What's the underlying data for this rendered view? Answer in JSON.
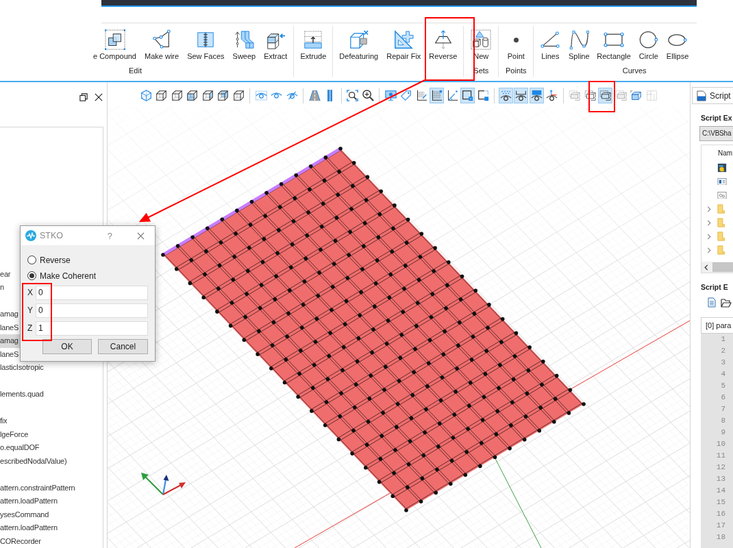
{
  "ribbon": {
    "groups": [
      {
        "label": "Edit",
        "buttons": [
          {
            "kind": "compound",
            "label": "e Compound"
          },
          {
            "kind": "wire",
            "label": "Make wire"
          },
          {
            "kind": "sew",
            "label": "Sew Faces"
          },
          {
            "kind": "sweep",
            "label": "Sweep"
          },
          {
            "kind": "extract",
            "label": "Extract"
          }
        ]
      },
      {
        "buttons": [
          {
            "kind": "extrude",
            "label": "Extrude"
          }
        ]
      },
      {
        "buttons": [
          {
            "kind": "defeature",
            "label": "Defeaturing"
          },
          {
            "kind": "repair",
            "label": "Repair Fix"
          },
          {
            "kind": "reverse",
            "label": "Reverse"
          }
        ]
      },
      {
        "label": "Sets",
        "buttons": [
          {
            "kind": "sets",
            "label": "New"
          }
        ]
      },
      {
        "label": "Points",
        "buttons": [
          {
            "kind": "point",
            "label": "Point"
          }
        ]
      },
      {
        "label": "Curves",
        "buttons": [
          {
            "kind": "line",
            "label": "Lines"
          },
          {
            "kind": "spline",
            "label": "Spline"
          },
          {
            "kind": "rectangle",
            "label": "Rectangle"
          },
          {
            "kind": "circle",
            "label": "Circle"
          },
          {
            "kind": "ellipse",
            "label": "Ellipse"
          }
        ]
      }
    ]
  },
  "view_toolbar": {
    "groups": [
      [
        {
          "kind": "iso",
          "on": false
        },
        {
          "kind": "cube",
          "on": false
        },
        {
          "kind": "cube",
          "on": false
        },
        {
          "kind": "cubefront",
          "on": false
        },
        {
          "kind": "cubeside",
          "on": false
        },
        {
          "kind": "cubeback",
          "on": false
        },
        {
          "kind": "cube",
          "on": false
        }
      ],
      [
        {
          "kind": "eyeframe",
          "on": false
        },
        {
          "kind": "eye",
          "on": false
        },
        {
          "kind": "eyeslash",
          "on": false
        }
      ],
      [
        {
          "kind": "road",
          "on": false
        },
        {
          "kind": "bar",
          "on": false
        }
      ],
      [
        {
          "kind": "zoomfit",
          "on": false
        },
        {
          "kind": "zoom",
          "on": false
        }
      ],
      [
        {
          "kind": "monitor",
          "on": false
        },
        {
          "kind": "tag",
          "on": false
        },
        {
          "kind": "gridaxis",
          "on": false
        },
        {
          "kind": "grid",
          "on": true
        },
        {
          "kind": "angle",
          "on": false
        },
        {
          "kind": "frame",
          "on": true
        },
        {
          "kind": "framepick",
          "on": false
        }
      ],
      [
        {
          "kind": "eyedots",
          "on": true
        },
        {
          "kind": "eyearc",
          "on": true
        },
        {
          "kind": "eyefill",
          "on": true
        },
        {
          "kind": "eyearrow",
          "on": false
        }
      ],
      [
        {
          "kind": "stackfaint",
          "on": false
        },
        {
          "kind": "stackline",
          "on": false
        },
        {
          "kind": "stack",
          "on": true
        },
        {
          "kind": "stackfaint",
          "on": false
        },
        {
          "kind": "stackblue",
          "on": false
        },
        {
          "kind": "gridfaint",
          "on": false
        }
      ]
    ]
  },
  "tree": {
    "items": [
      {
        "label": "ear",
        "selected": false
      },
      {
        "label": "n",
        "selected": false
      },
      {
        "selected": false,
        "children": [
          {
            "label": "amag",
            "selected": false
          },
          {
            "label": "laneS",
            "selected": false
          },
          {
            "label": "amag",
            "selected": true
          },
          {
            "label": "laneS",
            "selected": false
          },
          {
            "label": "lasticIsotropic",
            "selected": false
          }
        ]
      },
      {
        "selected": false,
        "children": [
          {
            "label": "lements.quad",
            "selected": false
          }
        ]
      },
      {
        "selected": false,
        "children": [
          {
            "label": "fix",
            "selected": false
          },
          {
            "label": "lgeForce",
            "selected": false
          },
          {
            "label": "o.equalDOF",
            "selected": false
          },
          {
            "label": "escribedNodalValue)",
            "selected": false
          }
        ]
      },
      {
        "selected": false,
        "children": [
          {
            "label": "attern.constraintPattern",
            "selected": false
          },
          {
            "label": "attern.loadPattern",
            "selected": false
          },
          {
            "label": "ysesCommand",
            "selected": false
          },
          {
            "label": "attern.loadPattern",
            "selected": false
          },
          {
            "label": "CORecorder",
            "selected": false
          }
        ]
      }
    ]
  },
  "script_panel": {
    "tab": "Script",
    "explorer": {
      "title": "Script Ex",
      "path": "C:\\VBSha",
      "column": "Nam",
      "files": [
        {
          "kind": "python"
        },
        {
          "kind": "form"
        },
        {
          "kind": "config"
        },
        {
          "kind": "folder"
        },
        {
          "kind": "folder"
        },
        {
          "kind": "folder"
        },
        {
          "kind": "folder"
        }
      ]
    },
    "editor": {
      "title": "Script E",
      "tab": "[0] para",
      "line_numbers": [
        "1",
        "2",
        "3",
        "4",
        "5",
        "6",
        "7",
        "8",
        "9",
        "10",
        "11",
        "12",
        "13",
        "14",
        "15",
        "16",
        "17",
        "18"
      ]
    }
  },
  "dialog": {
    "title": "STKO",
    "help": "?",
    "options": [
      {
        "label": "Reverse",
        "selected": false
      },
      {
        "label": "Make Coherent",
        "selected": true
      }
    ],
    "fields": [
      {
        "label": "X",
        "value": "0"
      },
      {
        "label": "Y",
        "value": "0"
      },
      {
        "label": "Z",
        "value": "1"
      }
    ],
    "buttons": [
      "OK",
      "Cancel"
    ]
  }
}
